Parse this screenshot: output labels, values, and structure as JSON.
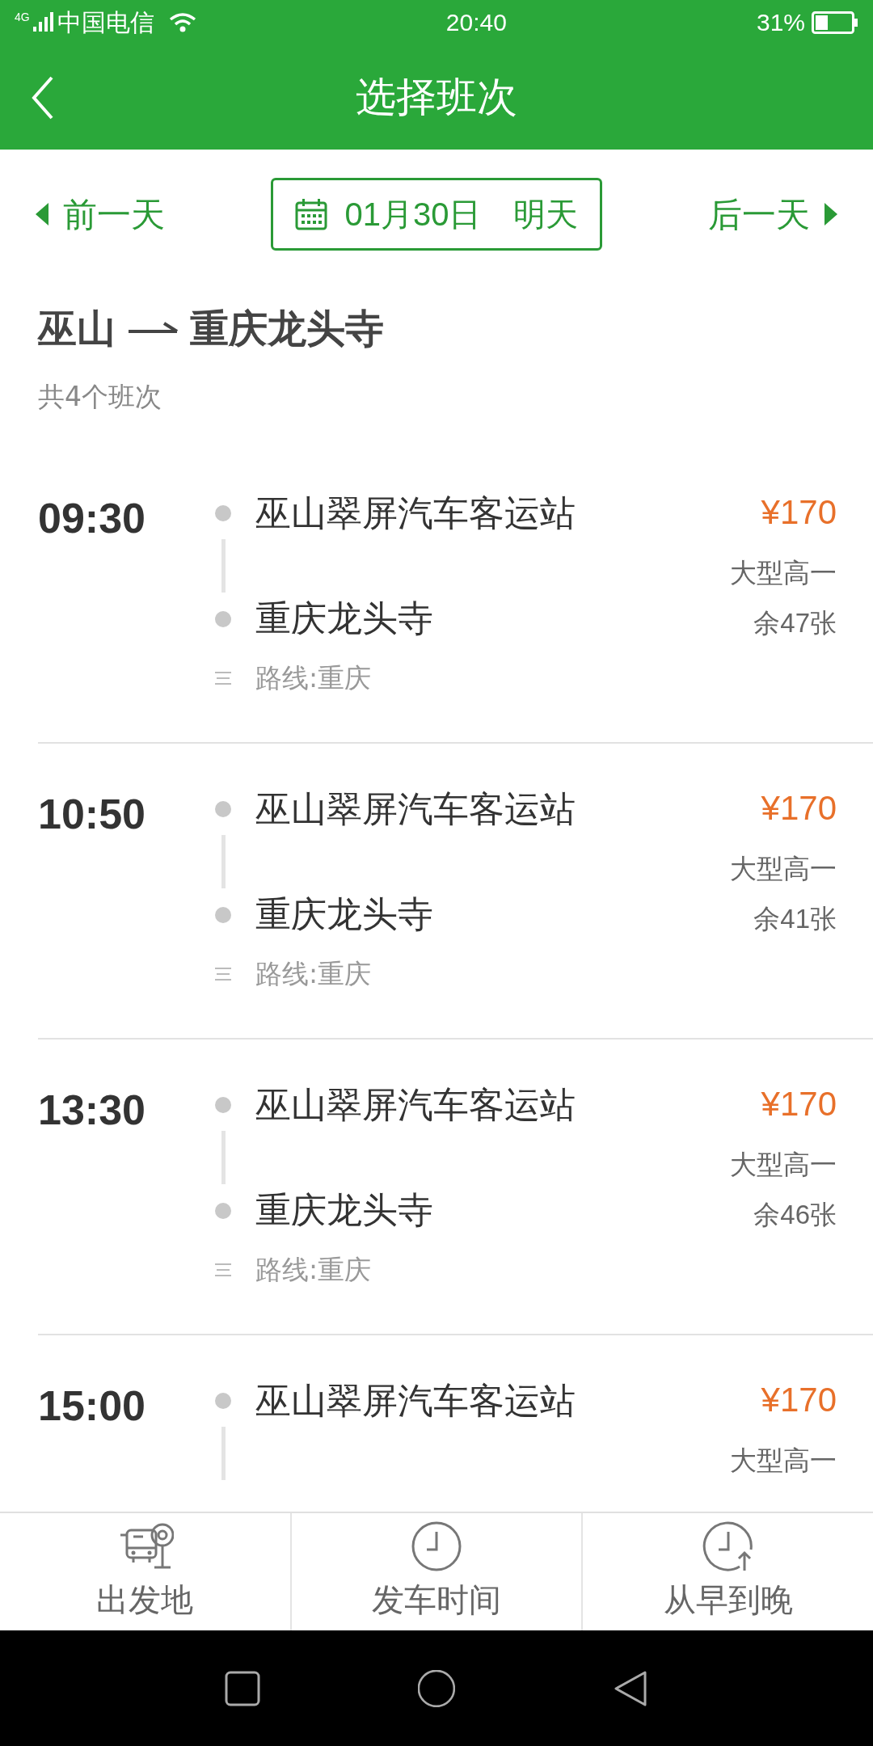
{
  "status_bar": {
    "network": "4G",
    "carrier": "中国电信",
    "time": "20:40",
    "battery": "31%"
  },
  "header": {
    "title": "选择班次"
  },
  "date_bar": {
    "prev": "前一天",
    "date": "01月30日",
    "day_label": "明天",
    "next": "后一天"
  },
  "route": {
    "from": "巫山",
    "to": "重庆龙头寺",
    "count": "共4个班次"
  },
  "trips": [
    {
      "time": "09:30",
      "from": "巫山翠屏汽车客运站",
      "to": "重庆龙头寺",
      "route": "路线:重庆",
      "price": "¥170",
      "bus_type": "大型高一",
      "seats": "余47张"
    },
    {
      "time": "10:50",
      "from": "巫山翠屏汽车客运站",
      "to": "重庆龙头寺",
      "route": "路线:重庆",
      "price": "¥170",
      "bus_type": "大型高一",
      "seats": "余41张"
    },
    {
      "time": "13:30",
      "from": "巫山翠屏汽车客运站",
      "to": "重庆龙头寺",
      "route": "路线:重庆",
      "price": "¥170",
      "bus_type": "大型高一",
      "seats": "余46张"
    },
    {
      "time": "15:00",
      "from": "巫山翠屏汽车客运站",
      "price": "¥170",
      "bus_type": "大型高一"
    }
  ],
  "bottom_tabs": [
    {
      "kind": "origin",
      "label": "出发地"
    },
    {
      "kind": "time",
      "label": "发车时间"
    },
    {
      "kind": "order",
      "label": "从早到晚"
    }
  ]
}
